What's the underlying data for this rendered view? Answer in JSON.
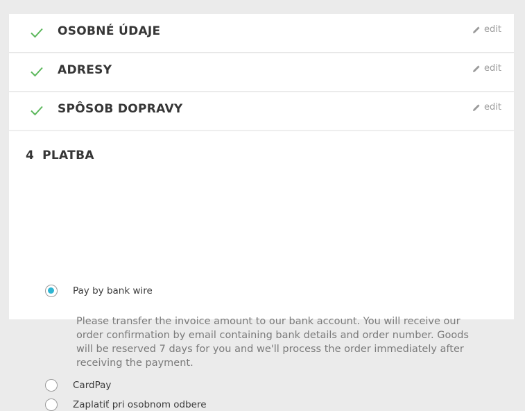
{
  "steps": [
    {
      "title": "OSOBNÉ ÚDAJE",
      "edit_label": "edit"
    },
    {
      "title": "ADRESY",
      "edit_label": "edit"
    },
    {
      "title": "SPÔSOB DOPRAVY",
      "edit_label": "edit"
    }
  ],
  "payment": {
    "number": "4",
    "title": "PLATBA",
    "options": [
      {
        "label": "Pay by bank wire",
        "selected": true
      },
      {
        "label": "CardPay",
        "selected": false
      },
      {
        "label": "Zaplatiť pri osobnom odbere",
        "selected": false
      }
    ],
    "bank_wire_description": "Please transfer the invoice amount to our bank account. You will receive our order confirmation by email containing bank details and order number. Goods will be reserved 7 days for you and we'll process the order immediately after receiving the payment."
  },
  "colors": {
    "check": "#5cb85c",
    "radio_accent": "#2fb5d2",
    "edit_text": "#9a9a9a"
  },
  "icons": {
    "check": "check-icon",
    "edit": "pencil-icon"
  }
}
